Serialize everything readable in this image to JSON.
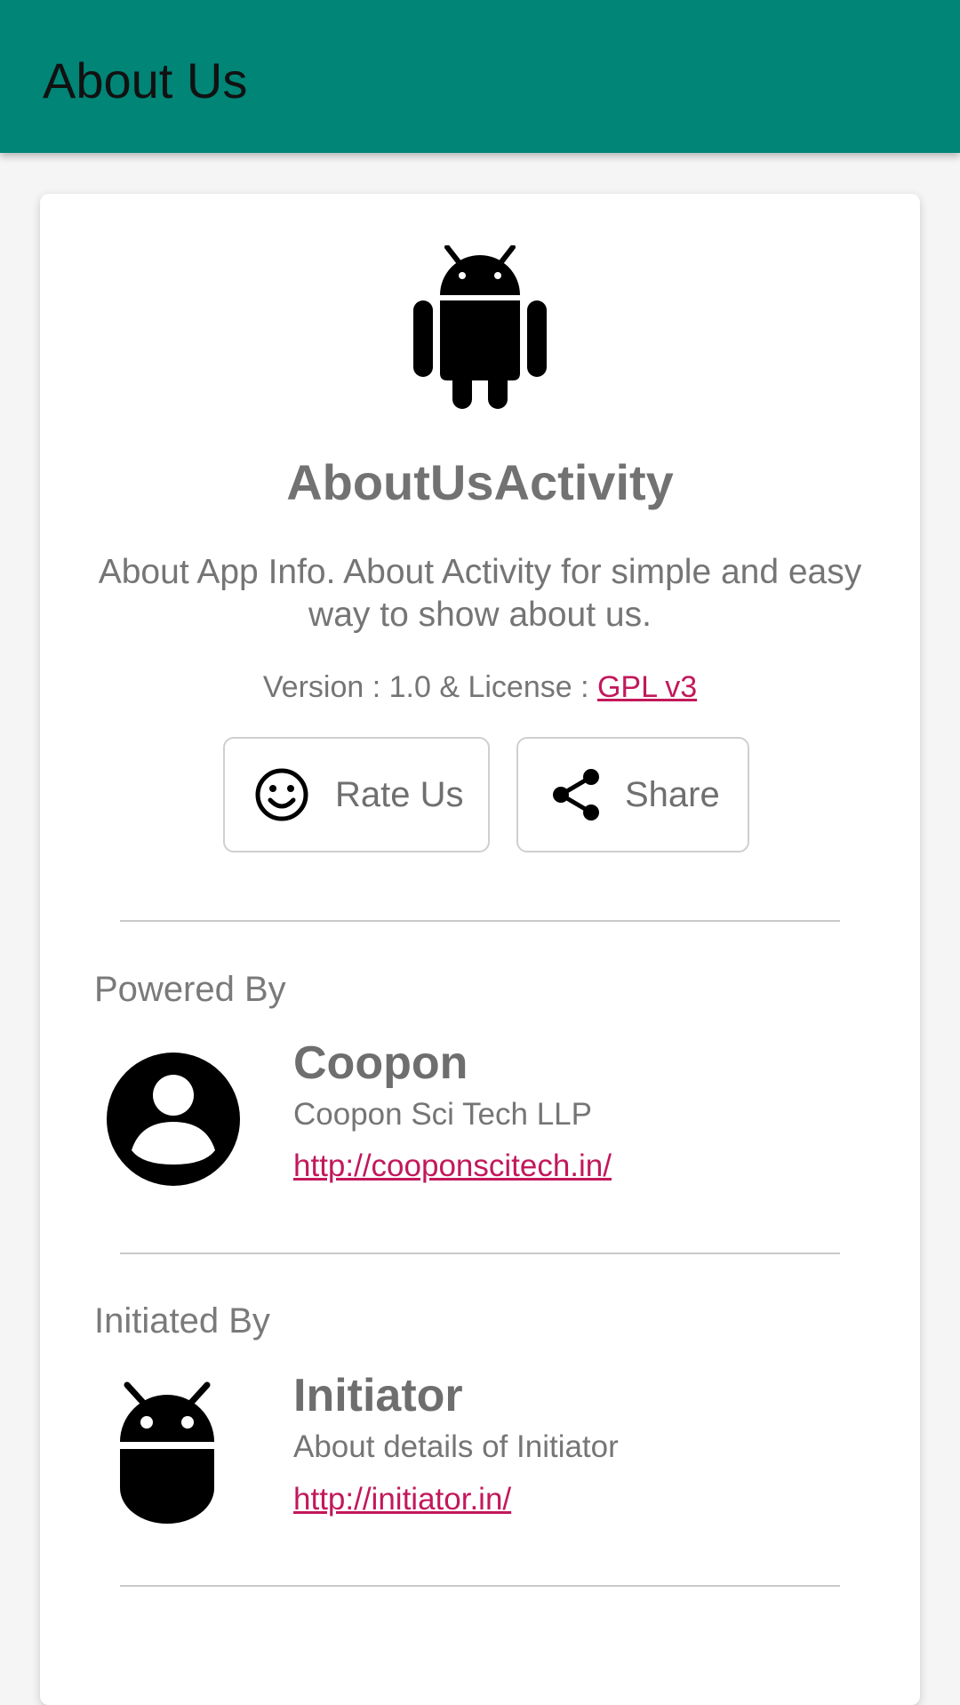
{
  "toolbar": {
    "title": "About Us",
    "color": "#008577"
  },
  "app": {
    "icon": "android-icon",
    "name": "AboutUsActivity",
    "description": "About App Info. About Activity for simple and easy way to show about us.",
    "version_prefix": "Version : 1.0 & License : ",
    "license_label": "GPL v3"
  },
  "buttons": {
    "rate": {
      "label": "Rate Us",
      "icon": "smiley-icon"
    },
    "share": {
      "label": "Share",
      "icon": "share-icon"
    }
  },
  "powered_by": {
    "section_label": "Powered By",
    "icon": "account-circle-icon",
    "name": "Coopon",
    "description": "Coopon Sci Tech LLP",
    "url": "http://cooponscitech.in/"
  },
  "initiated_by": {
    "section_label": "Initiated By",
    "icon": "android-head-icon",
    "name": "Initiator",
    "description": "About details of Initiator",
    "url": "http://initiator.in/"
  },
  "colors": {
    "link": "#c2185b",
    "text_secondary": "#757575"
  }
}
